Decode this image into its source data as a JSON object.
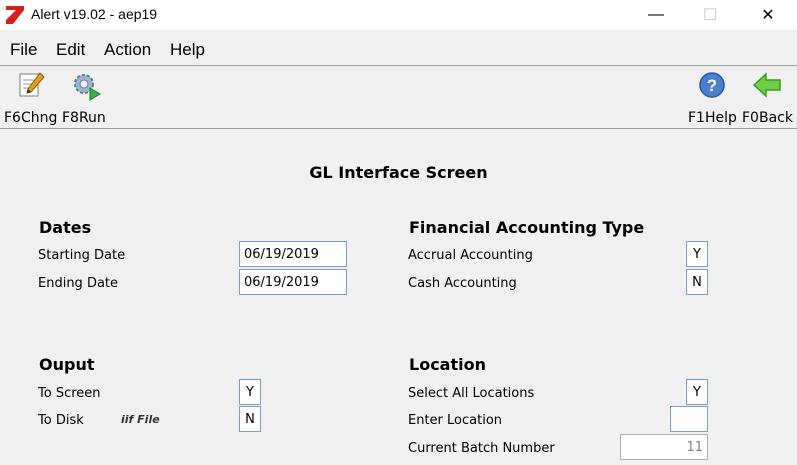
{
  "window": {
    "title": "Alert v19.02 - aep19",
    "minimize": "—",
    "maximize": "☐",
    "close": "✕"
  },
  "menu": [
    "File",
    "Edit",
    "Action",
    "Help"
  ],
  "toolbar": {
    "change_label": "F6Chng",
    "run_label": "F8Run",
    "help_label": "F1Help",
    "back_label": "F0Back"
  },
  "screen_title": "GL Interface Screen",
  "dates": {
    "heading": "Dates",
    "starting_label": "Starting Date",
    "starting_value": "06/19/2019",
    "ending_label": "Ending Date",
    "ending_value": "06/19/2019"
  },
  "accounting": {
    "heading": "Financial Accounting Type",
    "accrual_label": "Accrual Accounting",
    "accrual_value": "Y",
    "cash_label": "Cash Accounting",
    "cash_value": "N"
  },
  "output": {
    "heading": "Ouput",
    "screen_label": "To Screen",
    "screen_value": "Y",
    "disk_label": "To Disk",
    "disk_note": "iif File",
    "disk_value": "N"
  },
  "location": {
    "heading": "Location",
    "select_all_label": "Select All Locations",
    "select_all_value": "Y",
    "enter_label": "Enter Location",
    "enter_value": "",
    "batch_label": "Current Batch Number",
    "batch_value": "11"
  }
}
